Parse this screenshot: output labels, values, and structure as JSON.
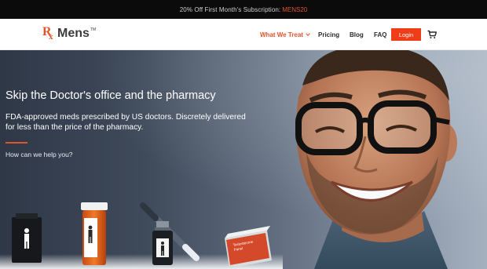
{
  "promo": {
    "text": "20% Off First Month's Subscription:",
    "code": "MENS20"
  },
  "header": {
    "logo": {
      "rx_r": "R",
      "rx_x": "x",
      "name": "Mens",
      "tm": "TM"
    },
    "nav": {
      "what_we_treat": "What We Treat",
      "pricing": "Pricing",
      "blog": "Blog",
      "faq": "FAQ"
    },
    "login_label": "Login"
  },
  "hero": {
    "title": "Skip the Doctor's office and the pharmacy",
    "description": "FDA-approved meds prescribed by US doctors. Discretely delivered for less than the price of the pharmacy.",
    "help": "How can we help you?"
  },
  "products": {
    "box_label_1": "Testosterone",
    "box_label_2": "Panel"
  },
  "colors": {
    "accent": "#e0542b",
    "login_bg": "#ef3d1a",
    "promo_bg": "#0b0b0b"
  }
}
